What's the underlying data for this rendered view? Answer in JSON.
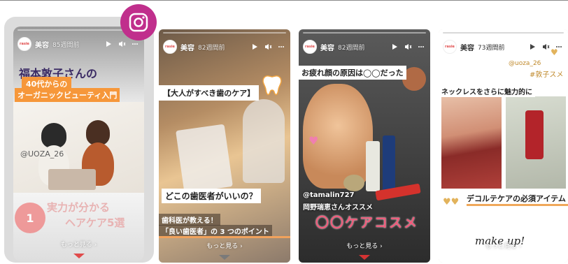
{
  "stories": [
    {
      "account": "美容",
      "ago": "85週間前",
      "more": "もっと見る ›",
      "title_line1": "福本敦子さんの",
      "title_line2": "40代からの",
      "title_line3": "オーガニックビューティ入門",
      "handle": "@UOZA_26",
      "badge_num": "1",
      "bottom_line1": "実力が分かる",
      "bottom_line2": "ヘアケア5選"
    },
    {
      "account": "美容",
      "ago": "82週間前",
      "more": "もっと見る ›",
      "title": "【大人がすべき歯のケア】",
      "question": "どこの歯医者がいいの？",
      "line1": "歯科医が教える！",
      "line2": "「良い歯医者」の 3 つのポイント"
    },
    {
      "account": "美容",
      "ago": "82週間前",
      "more": "もっと見る ›",
      "title": "お疲れ顔の原因は◯◯だった",
      "handle": "@tamalin727",
      "recommend": "岡野瑞恵さんオススメ",
      "big": "〇〇ケアコスメ"
    },
    {
      "account": "美容",
      "ago": "73週間前",
      "handle1": "@uoza_26",
      "handle2": "#敦子スメ",
      "caption": "ネックレスをさらに魅力的に",
      "bottom": "デコルテケアの必須アイテム",
      "signature": "make up!",
      "more": "もっと見る ›"
    }
  ],
  "icons": {
    "brand": "instagram-icon",
    "play": "play-icon",
    "mute": "mute-icon",
    "menu": "more-icon"
  },
  "colors": {
    "instagram": "#c02f8c",
    "accent_orange": "#f6973a",
    "pink": "#f05a7a"
  }
}
